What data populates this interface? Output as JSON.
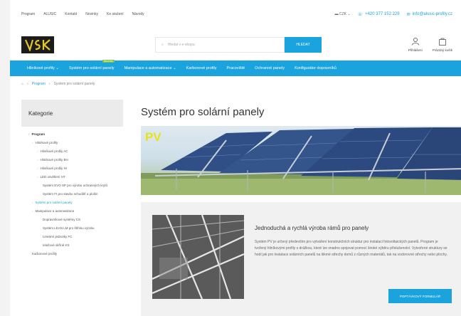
{
  "topbar": {
    "links": [
      "Program",
      "ALUSIC",
      "Kontakt",
      "Novinky",
      "Ke stažení",
      "Návody"
    ],
    "lang": "CZK",
    "phone": "+420 377 152 229",
    "email": "info@alusic-profily.cz"
  },
  "header": {
    "search_placeholder": "Hledat v e-shopu",
    "search_button": "HLEDAT",
    "login_label": "Přihlášení",
    "cart_label": "Prázdný košík"
  },
  "nav": {
    "items": [
      "Hliníkové profily",
      "Systém pro solární panely",
      "Manipulace a automatizace",
      "Karbonové profily",
      "Pracoviště",
      "Ochranné panely",
      "Konfigurátor dopravníků"
    ],
    "badge": "Novinka"
  },
  "breadcrumb": {
    "items": [
      "Program",
      "Systém pro solární panely"
    ]
  },
  "sidebar": {
    "heading": "Kategorie",
    "items": [
      {
        "label": "Program",
        "level": 0,
        "active": false
      },
      {
        "label": "Hliníkové profily",
        "level": 1,
        "active": false
      },
      {
        "label": "Hliníkové profily AC",
        "level": 2,
        "active": false
      },
      {
        "label": "Hliníkové profily BH",
        "level": 2,
        "active": false
      },
      {
        "label": "Hliníkové profily IH",
        "level": 2,
        "active": false
      },
      {
        "label": "LED osvětlení HT",
        "level": 2,
        "active": false
      },
      {
        "label": "Systém EVO SP pro výrobu ochranných krytů",
        "level": 3,
        "active": false
      },
      {
        "label": "Systém FI pro stavbu schodišť a plošin",
        "level": 3,
        "active": false
      },
      {
        "label": "Systém pro solární panely",
        "level": 1,
        "active": true
      },
      {
        "label": "Manipulace a automatizace",
        "level": 1,
        "active": false
      },
      {
        "label": "Dopravníkové systémy CS",
        "level": 2,
        "active": false
      },
      {
        "label": "Systém LEAN LM pro štíhlou výrobu",
        "level": 3,
        "active": false
      },
      {
        "label": "Lineární jednotky FC",
        "level": 3,
        "active": false
      },
      {
        "label": "Ielažové skříně KS",
        "level": 3,
        "active": false
      },
      {
        "label": "Karbonové profily",
        "level": 1,
        "active": false
      }
    ]
  },
  "main": {
    "title": "Systém pro solární panely",
    "banner_label": "PV",
    "card": {
      "title": "Jednoduchá a rychlá výroba rámů pro panely",
      "text": "Systém PV je určený především pro vytváření konstrukčních struktur pro instalaci fotovoltaických panelů. Program je tvořený hliníkovými profily s drážkou, které lze snadno spojovat pomocí široké výběru příslušenství. Vytvořené struktury se hodí jak pro instalace solárních panelů na šikmé střechy domů z různých materiálů, tak na vodorovné střechy nebo plochy.",
      "button": "POPTÁVKOVÝ FORMULÁŘ"
    }
  },
  "colors": {
    "accent": "#1aa3dc",
    "badge": "#7ec242",
    "pv_label": "#e7e31a"
  }
}
